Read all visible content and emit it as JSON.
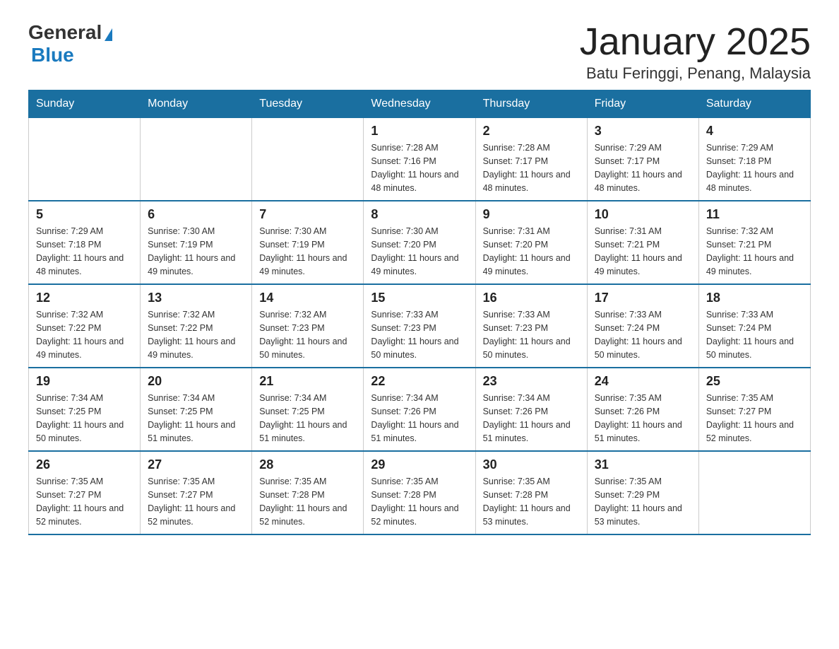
{
  "header": {
    "logo": {
      "general": "General",
      "blue": "Blue",
      "tagline": ""
    },
    "title": "January 2025",
    "subtitle": "Batu Feringgi, Penang, Malaysia"
  },
  "days_of_week": [
    "Sunday",
    "Monday",
    "Tuesday",
    "Wednesday",
    "Thursday",
    "Friday",
    "Saturday"
  ],
  "weeks": [
    [
      {
        "day": "",
        "sunrise": "",
        "sunset": "",
        "daylight": ""
      },
      {
        "day": "",
        "sunrise": "",
        "sunset": "",
        "daylight": ""
      },
      {
        "day": "",
        "sunrise": "",
        "sunset": "",
        "daylight": ""
      },
      {
        "day": "1",
        "sunrise": "Sunrise: 7:28 AM",
        "sunset": "Sunset: 7:16 PM",
        "daylight": "Daylight: 11 hours and 48 minutes."
      },
      {
        "day": "2",
        "sunrise": "Sunrise: 7:28 AM",
        "sunset": "Sunset: 7:17 PM",
        "daylight": "Daylight: 11 hours and 48 minutes."
      },
      {
        "day": "3",
        "sunrise": "Sunrise: 7:29 AM",
        "sunset": "Sunset: 7:17 PM",
        "daylight": "Daylight: 11 hours and 48 minutes."
      },
      {
        "day": "4",
        "sunrise": "Sunrise: 7:29 AM",
        "sunset": "Sunset: 7:18 PM",
        "daylight": "Daylight: 11 hours and 48 minutes."
      }
    ],
    [
      {
        "day": "5",
        "sunrise": "Sunrise: 7:29 AM",
        "sunset": "Sunset: 7:18 PM",
        "daylight": "Daylight: 11 hours and 48 minutes."
      },
      {
        "day": "6",
        "sunrise": "Sunrise: 7:30 AM",
        "sunset": "Sunset: 7:19 PM",
        "daylight": "Daylight: 11 hours and 49 minutes."
      },
      {
        "day": "7",
        "sunrise": "Sunrise: 7:30 AM",
        "sunset": "Sunset: 7:19 PM",
        "daylight": "Daylight: 11 hours and 49 minutes."
      },
      {
        "day": "8",
        "sunrise": "Sunrise: 7:30 AM",
        "sunset": "Sunset: 7:20 PM",
        "daylight": "Daylight: 11 hours and 49 minutes."
      },
      {
        "day": "9",
        "sunrise": "Sunrise: 7:31 AM",
        "sunset": "Sunset: 7:20 PM",
        "daylight": "Daylight: 11 hours and 49 minutes."
      },
      {
        "day": "10",
        "sunrise": "Sunrise: 7:31 AM",
        "sunset": "Sunset: 7:21 PM",
        "daylight": "Daylight: 11 hours and 49 minutes."
      },
      {
        "day": "11",
        "sunrise": "Sunrise: 7:32 AM",
        "sunset": "Sunset: 7:21 PM",
        "daylight": "Daylight: 11 hours and 49 minutes."
      }
    ],
    [
      {
        "day": "12",
        "sunrise": "Sunrise: 7:32 AM",
        "sunset": "Sunset: 7:22 PM",
        "daylight": "Daylight: 11 hours and 49 minutes."
      },
      {
        "day": "13",
        "sunrise": "Sunrise: 7:32 AM",
        "sunset": "Sunset: 7:22 PM",
        "daylight": "Daylight: 11 hours and 49 minutes."
      },
      {
        "day": "14",
        "sunrise": "Sunrise: 7:32 AM",
        "sunset": "Sunset: 7:23 PM",
        "daylight": "Daylight: 11 hours and 50 minutes."
      },
      {
        "day": "15",
        "sunrise": "Sunrise: 7:33 AM",
        "sunset": "Sunset: 7:23 PM",
        "daylight": "Daylight: 11 hours and 50 minutes."
      },
      {
        "day": "16",
        "sunrise": "Sunrise: 7:33 AM",
        "sunset": "Sunset: 7:23 PM",
        "daylight": "Daylight: 11 hours and 50 minutes."
      },
      {
        "day": "17",
        "sunrise": "Sunrise: 7:33 AM",
        "sunset": "Sunset: 7:24 PM",
        "daylight": "Daylight: 11 hours and 50 minutes."
      },
      {
        "day": "18",
        "sunrise": "Sunrise: 7:33 AM",
        "sunset": "Sunset: 7:24 PM",
        "daylight": "Daylight: 11 hours and 50 minutes."
      }
    ],
    [
      {
        "day": "19",
        "sunrise": "Sunrise: 7:34 AM",
        "sunset": "Sunset: 7:25 PM",
        "daylight": "Daylight: 11 hours and 50 minutes."
      },
      {
        "day": "20",
        "sunrise": "Sunrise: 7:34 AM",
        "sunset": "Sunset: 7:25 PM",
        "daylight": "Daylight: 11 hours and 51 minutes."
      },
      {
        "day": "21",
        "sunrise": "Sunrise: 7:34 AM",
        "sunset": "Sunset: 7:25 PM",
        "daylight": "Daylight: 11 hours and 51 minutes."
      },
      {
        "day": "22",
        "sunrise": "Sunrise: 7:34 AM",
        "sunset": "Sunset: 7:26 PM",
        "daylight": "Daylight: 11 hours and 51 minutes."
      },
      {
        "day": "23",
        "sunrise": "Sunrise: 7:34 AM",
        "sunset": "Sunset: 7:26 PM",
        "daylight": "Daylight: 11 hours and 51 minutes."
      },
      {
        "day": "24",
        "sunrise": "Sunrise: 7:35 AM",
        "sunset": "Sunset: 7:26 PM",
        "daylight": "Daylight: 11 hours and 51 minutes."
      },
      {
        "day": "25",
        "sunrise": "Sunrise: 7:35 AM",
        "sunset": "Sunset: 7:27 PM",
        "daylight": "Daylight: 11 hours and 52 minutes."
      }
    ],
    [
      {
        "day": "26",
        "sunrise": "Sunrise: 7:35 AM",
        "sunset": "Sunset: 7:27 PM",
        "daylight": "Daylight: 11 hours and 52 minutes."
      },
      {
        "day": "27",
        "sunrise": "Sunrise: 7:35 AM",
        "sunset": "Sunset: 7:27 PM",
        "daylight": "Daylight: 11 hours and 52 minutes."
      },
      {
        "day": "28",
        "sunrise": "Sunrise: 7:35 AM",
        "sunset": "Sunset: 7:28 PM",
        "daylight": "Daylight: 11 hours and 52 minutes."
      },
      {
        "day": "29",
        "sunrise": "Sunrise: 7:35 AM",
        "sunset": "Sunset: 7:28 PM",
        "daylight": "Daylight: 11 hours and 52 minutes."
      },
      {
        "day": "30",
        "sunrise": "Sunrise: 7:35 AM",
        "sunset": "Sunset: 7:28 PM",
        "daylight": "Daylight: 11 hours and 53 minutes."
      },
      {
        "day": "31",
        "sunrise": "Sunrise: 7:35 AM",
        "sunset": "Sunset: 7:29 PM",
        "daylight": "Daylight: 11 hours and 53 minutes."
      },
      {
        "day": "",
        "sunrise": "",
        "sunset": "",
        "daylight": ""
      }
    ]
  ]
}
